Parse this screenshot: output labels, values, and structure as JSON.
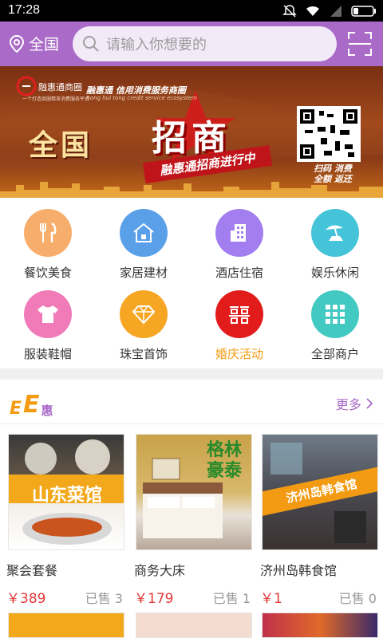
{
  "statusbar": {
    "time": "17:28"
  },
  "header": {
    "location": "全国",
    "search_placeholder": "请输入你想要的"
  },
  "banner": {
    "logo_name": "融惠通商圈",
    "logo_tagline": "一个打造商圈精准消费服务平台",
    "slogan": "融惠通 信用消费服务商圈",
    "slogan_en": "Rong hui tong credit service ecosystem",
    "headline_left": "全国",
    "headline_main": "招商",
    "ribbon": "融惠通招商进行中",
    "qr_caption_1": "扫码 消费",
    "qr_caption_2": "全额 返还",
    "slides": 6,
    "active_slide": 5
  },
  "categories": [
    {
      "label": "餐饮美食",
      "icon": "fork-knife-icon",
      "color": "#f7ad6b"
    },
    {
      "label": "家居建材",
      "icon": "house-icon",
      "color": "#5aa0e8"
    },
    {
      "label": "酒店住宿",
      "icon": "building-icon",
      "color": "#a27ef0"
    },
    {
      "label": "娱乐休闲",
      "icon": "beach-umbrella-icon",
      "color": "#45c3d8"
    },
    {
      "label": "服装鞋帽",
      "icon": "tshirt-icon",
      "color": "#f07bb8"
    },
    {
      "label": "珠宝首饰",
      "icon": "diamond-icon",
      "color": "#f6a623"
    },
    {
      "label": "婚庆活动",
      "icon": "double-happiness-icon",
      "color": "#e21b1b"
    },
    {
      "label": "全部商户",
      "icon": "grid-icon",
      "color": "#41c9c2"
    }
  ],
  "highlight_color": "#f39c12",
  "section": {
    "title_glyphs": [
      "E",
      "E",
      "惠"
    ],
    "more": "更多"
  },
  "products": [
    {
      "name": "聚会套餐",
      "price": "￥389",
      "sold": "已售 3",
      "badge": "山东菜馆"
    },
    {
      "name": "商务大床",
      "price": "￥179",
      "sold": "已售 1",
      "badge": "格林豪泰"
    },
    {
      "name": "济州岛韩食馆",
      "price": "￥1",
      "sold": "已售 0",
      "badge": "济州岛韩食馆"
    }
  ]
}
